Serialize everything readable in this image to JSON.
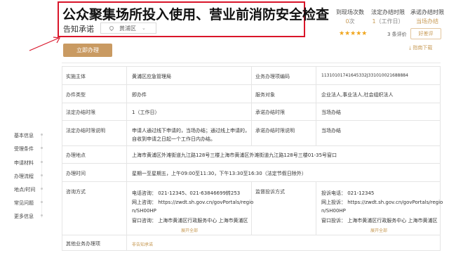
{
  "header": {
    "title": "公众聚集场所投入使用、营业前消防安全检查",
    "subtitle": "告知承诺",
    "region": "黄浦区"
  },
  "stats": [
    {
      "label": "到现场次数",
      "value": "0",
      "unit": "次"
    },
    {
      "label": "法定办结时限",
      "value": "1",
      "unit": "（工作日）"
    },
    {
      "label": "承诺办结时限",
      "value": "当场办结",
      "unit": ""
    }
  ],
  "rating": {
    "stars": "★★★★★",
    "text": "3 条评价",
    "good_button": "好差评",
    "download": "指南下载"
  },
  "apply_button": "立即办理",
  "nav": [
    "基本信息",
    "受理条件",
    "申请材料",
    "办理流程",
    "地点/时间",
    "常见问题",
    "更多信息"
  ],
  "table": {
    "impl_label": "实施主体",
    "impl_value": "黄浦区应急管理局",
    "code_label": "业务办理项编码",
    "code_value": "11310101741645332J331010021688884",
    "type_label": "办件类型",
    "type_value": "即办件",
    "target_label": "服务对象",
    "target_value": "企业法人,事业法人,社会组织法人",
    "legal_label": "法定办结时限",
    "legal_value": "1（工作日）",
    "promise_label": "承诺办结时限",
    "promise_value": "当场办结",
    "legal_desc_label": "法定办结时限说明",
    "legal_desc_line1": "申请人通过线下申请的，当场办结；通过线上申请的，",
    "legal_desc_line2": "自收到申请之日起一个工作日内办结。",
    "promise_desc_label": "承诺办结时限说明",
    "promise_desc_value": "当场办结",
    "place_label": "办理地点",
    "place_value": "上海市黄浦区外滩街道九江路128号三楼上海市黄浦区外滩街道九江路128号三楼01-35号窗口",
    "time_label": "办理时间",
    "time_value": "星期一至星期五，上午09:00至11:30，下午13:30至16:30（法定节假日除外）",
    "consult_label": "咨询方式",
    "consult_line1": "电话咨询：  021-12345、021-63846699转253",
    "consult_line2": "网上咨询：  https://zwdt.sh.gov.cn/govPortals/regio",
    "consult_line3": "n/SH00HP",
    "consult_line4": "窗口咨询：  上海市黄浦区行政服务中心 上海市黄浦区",
    "complain_label": "监督投诉方式",
    "complain_line1": "投诉电话：  021-12345",
    "complain_line2": "网上投诉：  https://zwdt.sh.gov.cn/govPortals/regio",
    "complain_line3": "n/SH00HP",
    "complain_line4": "窗口投诉：  上海市黄浦区行政服务中心 上海市黄浦区",
    "expand": "展开全部",
    "other_label": "其他业务办理项",
    "other_value": "非告知承诺"
  }
}
